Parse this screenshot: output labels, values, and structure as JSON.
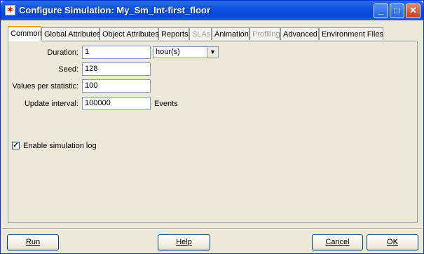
{
  "window": {
    "title": "Configure Simulation: My_Sm_Int-first_floor",
    "minimize": "_",
    "maximize": "□",
    "close": "✕"
  },
  "tabs": [
    {
      "label": "Common",
      "state": "active"
    },
    {
      "label": "Global Attributes",
      "state": "normal"
    },
    {
      "label": "Object Attributes",
      "state": "normal"
    },
    {
      "label": "Reports",
      "state": "normal"
    },
    {
      "label": "SLAs",
      "state": "disabled"
    },
    {
      "label": "Animation",
      "state": "normal"
    },
    {
      "label": "Profiling",
      "state": "disabled"
    },
    {
      "label": "Advanced",
      "state": "normal"
    },
    {
      "label": "Environment Files",
      "state": "normal"
    }
  ],
  "form": {
    "duration_label": "Duration:",
    "duration_value": "1",
    "duration_unit": "hour(s)",
    "seed_label": "Seed:",
    "seed_value": "128",
    "values_label": "Values per statistic:",
    "values_value": "100",
    "update_label": "Update interval:",
    "update_value": "100000",
    "update_unit": "Events",
    "log_label": "Enable simulation log",
    "log_checked": true
  },
  "buttons": {
    "run": "Run",
    "help": "Help",
    "cancel": "Cancel",
    "ok": "OK"
  },
  "colors": {
    "titlebar": "#0a53df",
    "active_tab_accent": "#e6a010",
    "dialog_bg": "#ece9d8"
  }
}
